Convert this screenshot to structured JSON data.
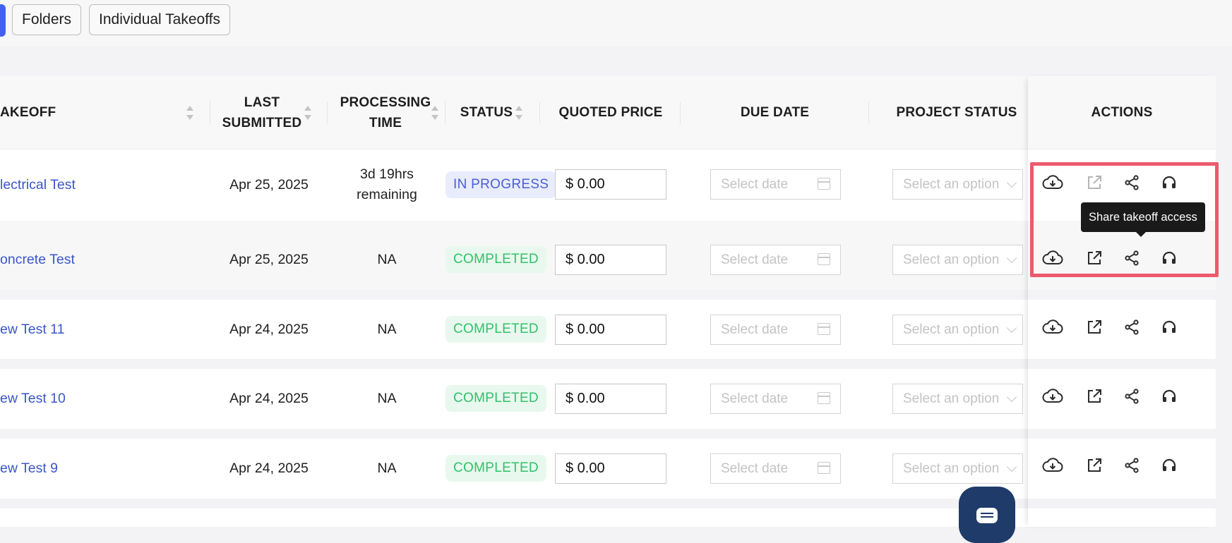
{
  "toolbar": {
    "tabs": [
      "Folders",
      "Individual Takeoffs"
    ]
  },
  "table": {
    "headers": {
      "takeoff": "AKEOFF",
      "last_submitted_1": "LAST",
      "last_submitted_2": "SUBMITTED",
      "processing_time_1": "PROCESSING",
      "processing_time_2": "TIME",
      "status": "STATUS",
      "quoted_price": "QUOTED PRICE",
      "due_date": "DUE DATE",
      "project_status": "PROJECT STATUS",
      "actions": "ACTIONS"
    },
    "rows": [
      {
        "name": "lectrical Test",
        "submitted": "Apr 25, 2025",
        "processing_1": "3d 19hrs",
        "processing_2": "remaining",
        "status": "IN PROGRESS",
        "price": "$ 0.00",
        "due_placeholder": "Select date",
        "project_placeholder": "Select an option"
      },
      {
        "name": "oncrete Test",
        "submitted": "Apr 25, 2025",
        "processing_1": "NA",
        "processing_2": "",
        "status": "COMPLETED",
        "price": "$ 0.00",
        "due_placeholder": "Select date",
        "project_placeholder": "Select an option"
      },
      {
        "name": "ew Test 11",
        "submitted": "Apr 24, 2025",
        "processing_1": "NA",
        "processing_2": "",
        "status": "COMPLETED",
        "price": "$ 0.00",
        "due_placeholder": "Select date",
        "project_placeholder": "Select an option"
      },
      {
        "name": "ew Test 10",
        "submitted": "Apr 24, 2025",
        "processing_1": "NA",
        "processing_2": "",
        "status": "COMPLETED",
        "price": "$ 0.00",
        "due_placeholder": "Select date",
        "project_placeholder": "Select an option"
      },
      {
        "name": "ew Test 9",
        "submitted": "Apr 24, 2025",
        "processing_1": "NA",
        "processing_2": "",
        "status": "COMPLETED",
        "price": "$ 0.00",
        "due_placeholder": "Select date",
        "project_placeholder": "Select an option"
      }
    ]
  },
  "tooltip": {
    "text": "Share takeoff access"
  },
  "icons": {
    "download": "cloud-download-icon",
    "open": "external-link-icon",
    "share": "share-icon",
    "support": "headphones-icon",
    "chat": "chat-icon",
    "calendar": "calendar-icon",
    "chevron": "chevron-down-icon"
  },
  "colors": {
    "accent": "#4361ee",
    "link": "#3b55c9",
    "in_progress_bg": "#e8ecfc",
    "in_progress_text": "#4a5fd1",
    "completed_bg": "#e8f8ee",
    "completed_text": "#34c06a",
    "highlight": "#ec5a6c"
  }
}
